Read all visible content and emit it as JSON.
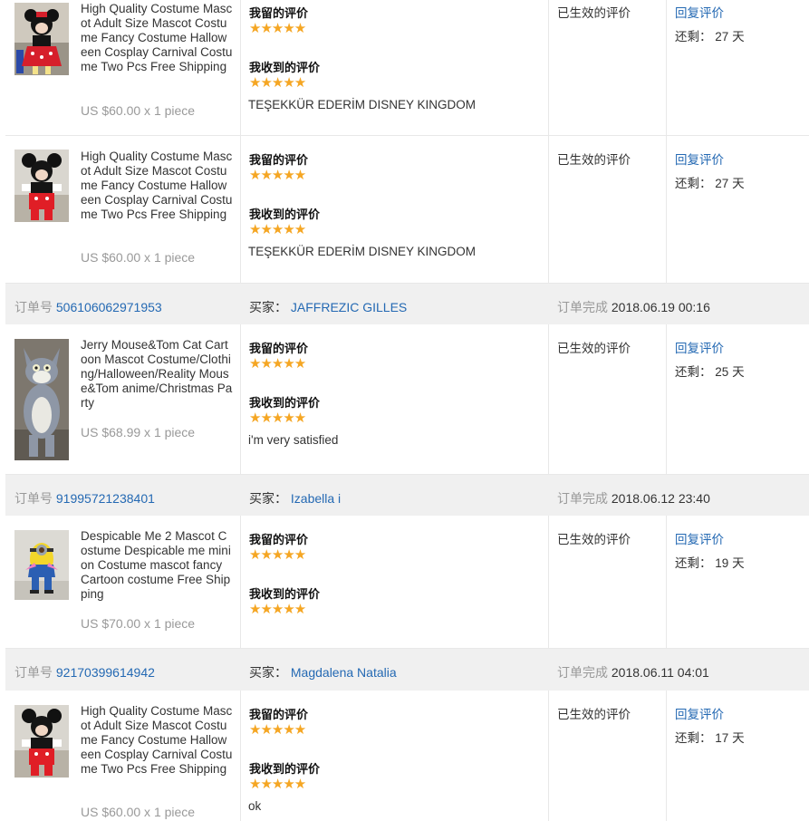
{
  "labels": {
    "left_review": "我留的评价",
    "received_review": "我收到的评价",
    "status": "已生效的评价",
    "reply": "回复评价",
    "remaining_prefix": "还剩：",
    "days_unit": "天",
    "order_no": "订单号",
    "buyer": "买家：",
    "completed": "订单完成"
  },
  "stars_glyph": "★★★★★",
  "colors": {
    "link": "#2469b3",
    "star": "#f5a623",
    "order_bg": "#f0f0f0",
    "muted": "#999999"
  },
  "items": [
    {
      "name": "High Quality Costume Mascot Adult Size Mascot Costume Fancy Costume Halloween Cosplay Carnival Costume Two Pcs Free Shipping",
      "price": "US $60.00 x 1 piece",
      "thumb": "minnie-mascot-photo",
      "my_rating": 5,
      "received_rating": 5,
      "received_comment": "TEŞEKKÜR EDERİM DISNEY KINGDOM",
      "remaining": "27"
    },
    {
      "name": "High Quality Costume Mascot Adult Size Mascot Costume Fancy Costume Halloween Cosplay Carnival Costume Two Pcs Free Shipping",
      "price": "US $60.00 x 1 piece",
      "thumb": "mickey-mascot-photo",
      "my_rating": 5,
      "received_rating": 5,
      "received_comment": "TEŞEKKÜR EDERİM DISNEY KINGDOM",
      "remaining": "27"
    },
    {
      "name": "Jerry Mouse&Tom Cat Cartoon Mascot Costume/Clothing/Halloween/Reality Mouse&Tom anime/Christmas Party",
      "price": "US $68.99 x 1 piece",
      "thumb": "tom-cat-mascot-photo",
      "my_rating": 5,
      "received_rating": 5,
      "received_comment": "i'm very satisfied",
      "remaining": "25"
    },
    {
      "name": "Despicable Me 2 Mascot Costume Despicable me minion Costume mascot fancy Cartoon costume Free Shipping",
      "price": "US $70.00 x 1 piece",
      "thumb": "minion-mascot-photo",
      "my_rating": 5,
      "received_rating": 5,
      "received_comment": "",
      "remaining": "19"
    },
    {
      "name": "High Quality Costume Mascot Adult Size Mascot Costume Fancy Costume Halloween Cosplay Carnival Costume Two Pcs Free Shipping",
      "price": "US $60.00 x 1 piece",
      "thumb": "mickey-mascot-photo",
      "my_rating": 5,
      "received_rating": 5,
      "received_comment": "ok",
      "remaining": "17"
    }
  ],
  "orders": [
    {
      "order_no": "506106062971953",
      "buyer": "JAFFREZIC GILLES",
      "completed_at": "2018.06.19 00:16"
    },
    {
      "order_no": "91995721238401",
      "buyer": "Izabella i",
      "completed_at": "2018.06.12 23:40"
    },
    {
      "order_no": "92170399614942",
      "buyer": "Magdalena Natalia",
      "completed_at": "2018.06.11 04:01"
    }
  ]
}
